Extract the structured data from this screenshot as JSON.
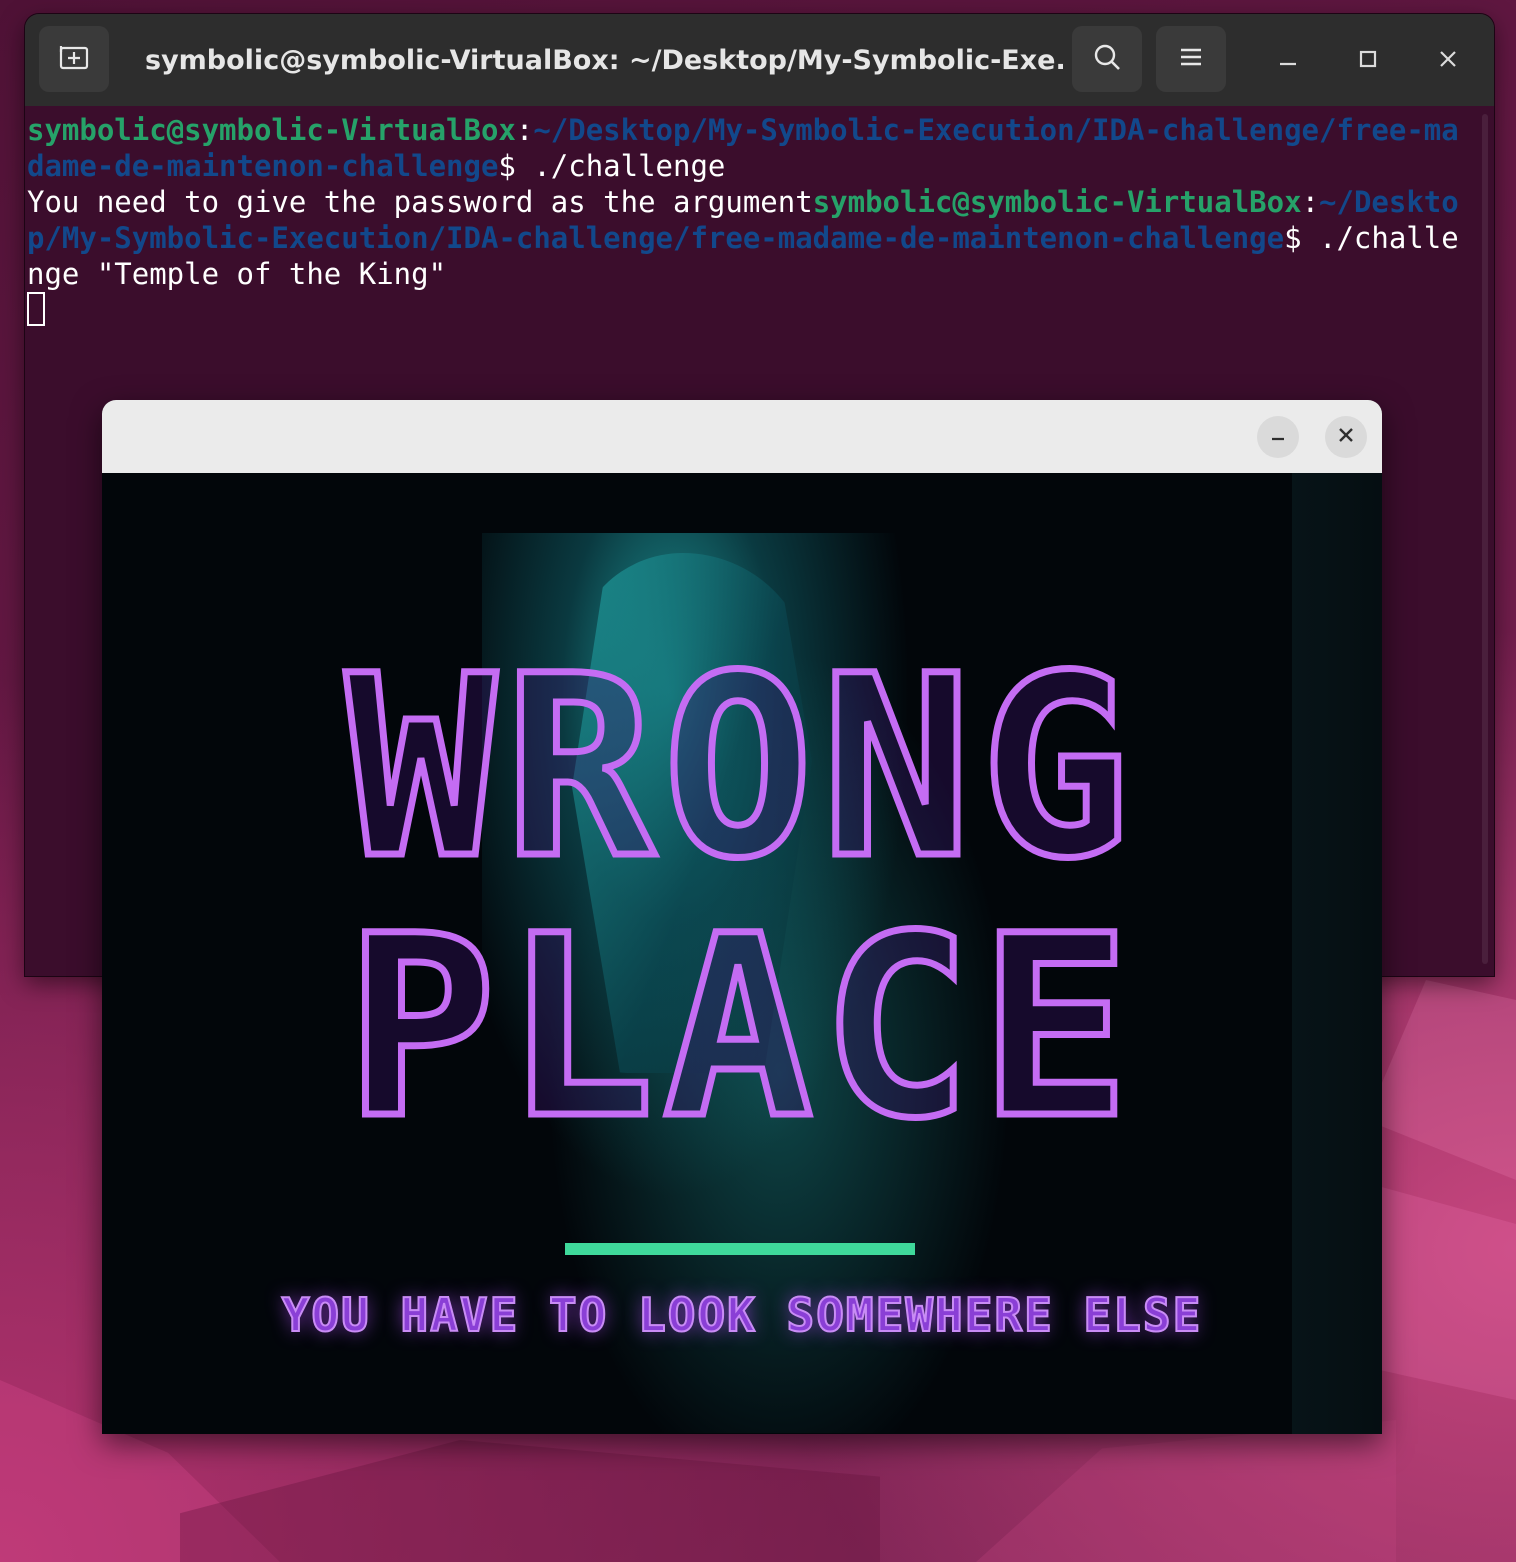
{
  "terminal": {
    "title": "symbolic@symbolic-VirtualBox: ~/Desktop/My-Symbolic-Exe...",
    "lines": [
      {
        "user": "symbolic@symbolic-VirtualBox",
        "colon": ":",
        "path": "~/Desktop/My-Symbolic-Execution/IDA-challenge/free-madame-de-maintenon-challenge",
        "cmd": "$ ./challenge"
      }
    ],
    "output": "You need to give the password as the argument",
    "line2": {
      "user": "symbolic@symbolic-VirtualBox",
      "colon": ":",
      "path": "~/Desktop/My-Symbolic-Execution/IDA-challenge/free-madame-de-maintenon-challenge",
      "cmd": "$ ./challenge \"Temple of the King\""
    }
  },
  "popup": {
    "headline_line1": "WRONG",
    "headline_line2": "PLACE",
    "subtitle": "YOU HAVE TO LOOK SOMEWHERE ELSE"
  },
  "colors": {
    "prompt_user": "#26a269",
    "prompt_path": "#12488b",
    "terminal_bg": "#3b0d2c",
    "headline_outline": "#c46cf3",
    "bar_accent": "#3fd99b"
  },
  "icons": [
    "new-tab-icon",
    "search-icon",
    "hamburger-menu-icon",
    "minimize-icon",
    "maximize-icon",
    "close-icon"
  ]
}
